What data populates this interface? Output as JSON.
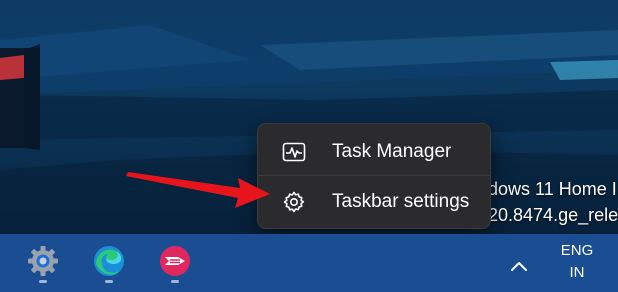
{
  "watermark": {
    "line1": "dows 11 Home I",
    "line2": "20.8474.ge_relea"
  },
  "context_menu": {
    "items": [
      {
        "label": "Task Manager",
        "icon": "task-manager-icon"
      },
      {
        "label": "Taskbar settings",
        "icon": "gear-icon"
      }
    ]
  },
  "taskbar": {
    "apps": [
      {
        "name": "Settings",
        "icon": "settings-gear-icon"
      },
      {
        "name": "Microsoft Edge",
        "icon": "edge-icon"
      },
      {
        "name": "Skitch",
        "icon": "skitch-icon"
      }
    ],
    "tray": {
      "chevron_icon": "chevron-up-icon",
      "language_line1": "ENG",
      "language_line2": "IN"
    }
  },
  "colors": {
    "taskbar": "#1a4d92",
    "menu_background": "#2b2b2d",
    "annotation_arrow": "#e8141c"
  }
}
